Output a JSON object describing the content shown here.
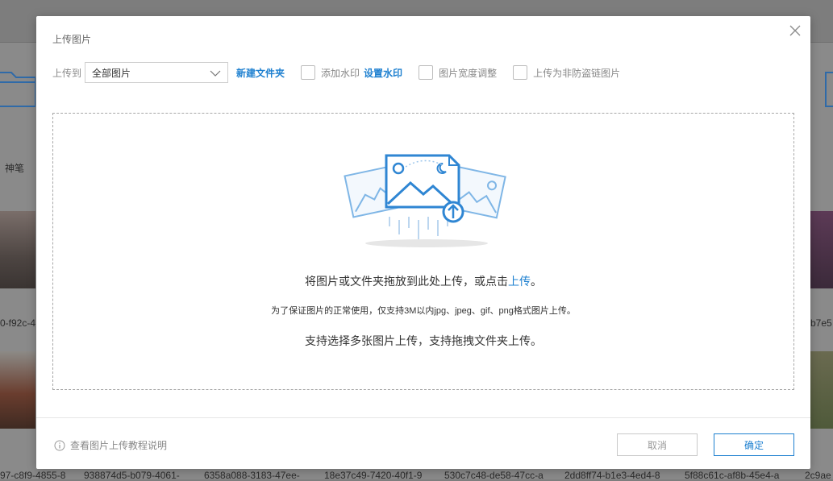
{
  "background": {
    "left_label": "神笔",
    "hash_left": "0-f92c-4",
    "hash_right": "b7e5",
    "bottom_hashes": [
      "97-c8f9-4855-8",
      "938874d5-b079-4061-",
      "6358a088-3183-47ee-",
      "18e37c49-7420-40f1-9",
      "530c7c48-de58-47cc-a",
      "2dd8ff74-b1e3-4ed4-8",
      "5f88c61c-af8b-45e4-a",
      "2c9ae"
    ]
  },
  "modal": {
    "title": "上传图片",
    "upload_to_label": "上传到",
    "folder_select_value": "全部图片",
    "new_folder_link": "新建文件夹",
    "watermark_label": "添加水印",
    "set_watermark_link": "设置水印",
    "width_adjust_label": "图片宽度调整",
    "non_hotlink_label": "上传为非防盗链图片",
    "dropzone": {
      "line1_prefix": "将图片或文件夹拖放到此处上传，或点击",
      "line1_link": "上传",
      "line1_suffix": "。",
      "line2": "为了保证图片的正常使用，仅支持3M以内jpg、jpeg、gif、png格式图片上传。",
      "line3": "支持选择多张图片上传，支持拖拽文件夹上传。"
    },
    "help_text": "查看图片上传教程说明",
    "cancel_label": "取消",
    "ok_label": "确定"
  },
  "colors": {
    "accent": "#1e80d0",
    "overlay": "#8a8a8a"
  }
}
